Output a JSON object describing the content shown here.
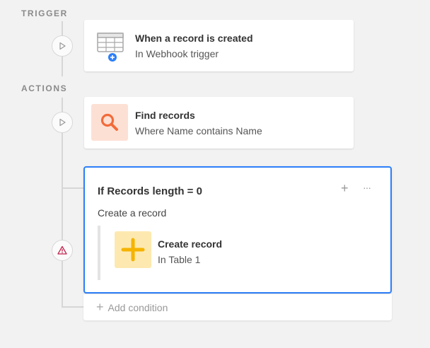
{
  "sections": {
    "trigger_label": "TRIGGER",
    "actions_label": "ACTIONS"
  },
  "trigger": {
    "title": "When a record is created",
    "subtitle": "In Webhook trigger",
    "icon": "table-add-icon"
  },
  "find_records": {
    "title": "Find records",
    "subtitle": "Where Name contains Name",
    "icon": "search-icon",
    "tile_color": "#fde0d4",
    "icon_color": "#f26b3a"
  },
  "condition": {
    "title": "If Records length = 0",
    "description": "Create a record",
    "add_icon": "+",
    "more_icon": "···",
    "action": {
      "title": "Create record",
      "subtitle": "In Table 1",
      "icon": "plus-icon",
      "tile_color": "#fde9b0",
      "icon_color": "#f5b400"
    }
  },
  "add_condition": {
    "plus": "+",
    "label": "Add condition"
  },
  "colors": {
    "accent": "#2d7ff9",
    "warning": "#c0264f"
  }
}
